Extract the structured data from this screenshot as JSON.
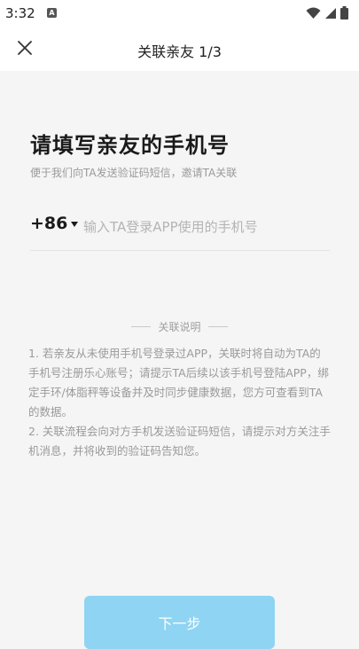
{
  "status_bar": {
    "time": "3:32",
    "app_icon_letter": "A",
    "icons": [
      "wifi-icon",
      "signal-icon",
      "battery-icon"
    ]
  },
  "nav": {
    "title": "关联亲友 1/3",
    "close_icon": "close-icon"
  },
  "form": {
    "heading": "请填写亲友的手机号",
    "subheading": "便于我们向TA发送验证码短信，邀请TA关联",
    "country_code": "+86",
    "phone_placeholder": "输入TA登录APP使用的手机号",
    "phone_value": ""
  },
  "explanation": {
    "title": "关联说明",
    "items": [
      "1. 若亲友从未使用手机号登录过APP，关联时将自动为TA的手机号注册乐心账号；请提示TA后续以该手机号登陆APP，绑定手环/体脂秤等设备并及时同步健康数据，您方可查看到TA的数据。",
      "2. 关联流程会向对方手机发送验证码短信，请提示对方关注手机消息，并将收到的验证码告知您。"
    ]
  },
  "actions": {
    "next_label": "下一步"
  },
  "colors": {
    "background": "#f5f5f6",
    "accent_button": "#8fd4f2",
    "muted_text": "#9a9a9a"
  }
}
